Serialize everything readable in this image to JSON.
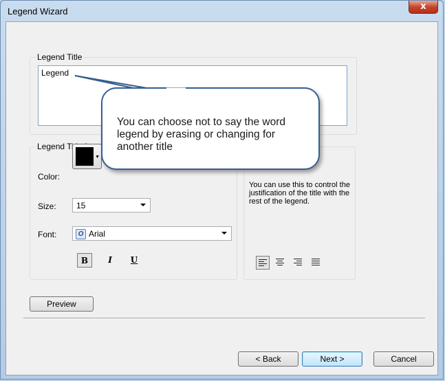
{
  "window": {
    "title": "Legend Wizard",
    "close_glyph": "x"
  },
  "legend_title": {
    "group_label": "Legend Title",
    "value": "Legend"
  },
  "title_font": {
    "group_label": "Legend Title fo",
    "color_label": "Color:",
    "color_value": "#000000",
    "size_label": "Size:",
    "size_value": "15",
    "font_label": "Font:",
    "font_value": "Arial",
    "bold_label": "B",
    "italic_label": "I",
    "underline_label": "U"
  },
  "justification": {
    "description": "You can use this to control the justification of the title with the rest of the legend.",
    "options": [
      "left",
      "center",
      "right",
      "full"
    ],
    "selected": "left"
  },
  "callout": {
    "text": "You can choose not to say the word legend by erasing or changing for another title"
  },
  "buttons": {
    "preview": "Preview",
    "back": "< Back",
    "next": "Next >",
    "cancel": "Cancel"
  }
}
